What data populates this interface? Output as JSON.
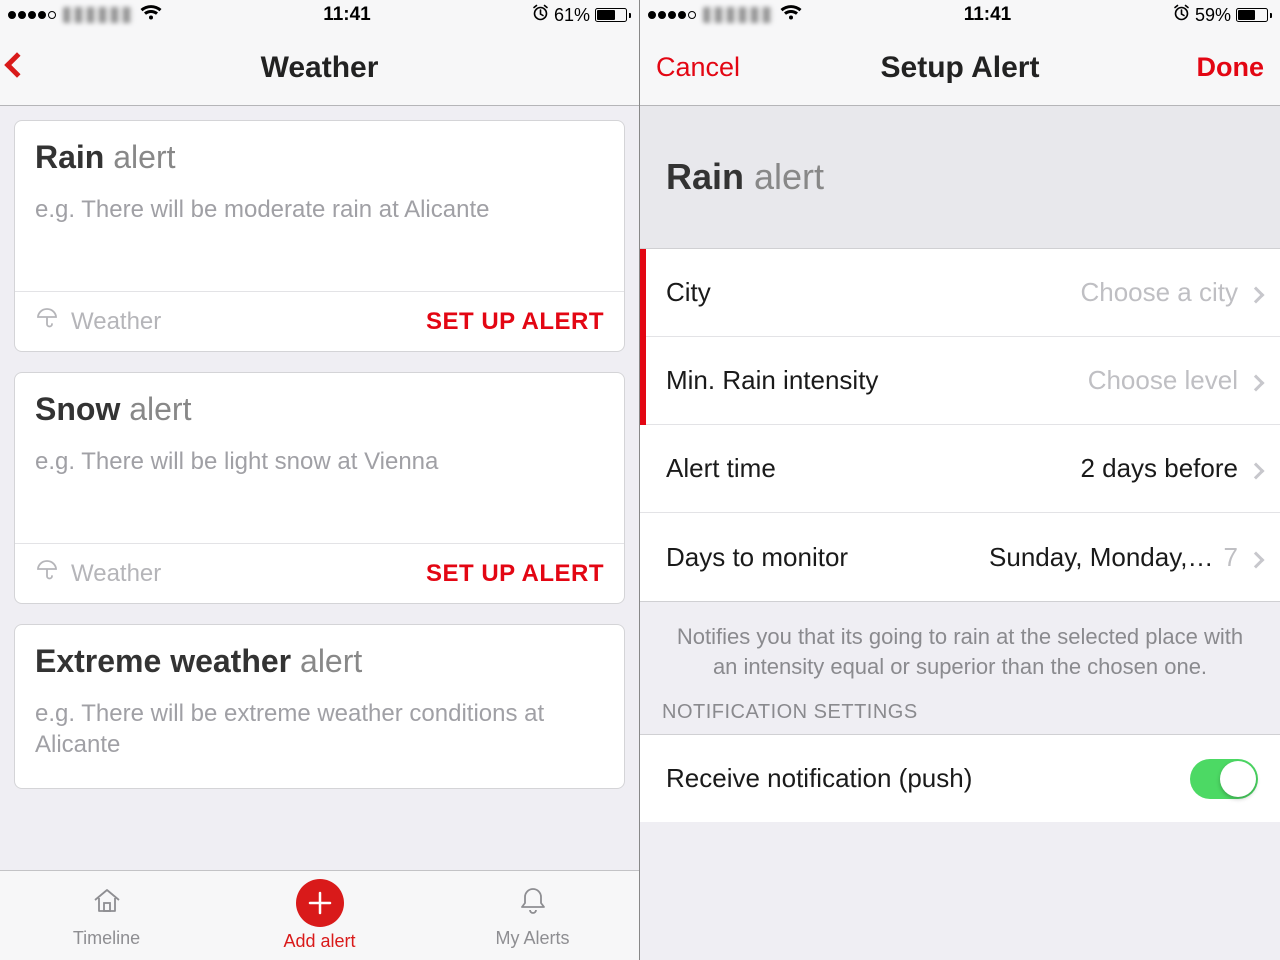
{
  "left": {
    "status": {
      "time": "11:41",
      "battery_pct": "61%",
      "battery_fill": 61
    },
    "nav": {
      "title": "Weather"
    },
    "cards": [
      {
        "title_bold": "Rain",
        "title_rest": " alert",
        "sub": "e.g. There will be moderate rain at Alicante",
        "cat": "Weather",
        "cta": "SET UP ALERT"
      },
      {
        "title_bold": "Snow",
        "title_rest": " alert",
        "sub": "e.g. There will be light snow at Vienna",
        "cat": "Weather",
        "cta": "SET UP ALERT"
      },
      {
        "title_bold": "Extreme weather",
        "title_rest": " alert",
        "sub": "e.g. There will be extreme weather conditions at Alicante",
        "cat": "Weather",
        "cta": "SET UP ALERT"
      }
    ],
    "tabs": {
      "timeline": "Timeline",
      "add": "Add alert",
      "myalerts": "My Alerts"
    }
  },
  "right": {
    "status": {
      "time": "11:41",
      "battery_pct": "59%",
      "battery_fill": 59
    },
    "nav": {
      "cancel": "Cancel",
      "title": "Setup Alert",
      "done": "Done"
    },
    "header": {
      "bold": "Rain",
      "rest": " alert"
    },
    "rows": {
      "city": {
        "label": "City",
        "value": "Choose a city"
      },
      "intensity": {
        "label": "Min. Rain intensity",
        "value": "Choose level"
      },
      "time": {
        "label": "Alert time",
        "value": "2 days before"
      },
      "days": {
        "label": "Days to monitor",
        "value": "Sunday, Monday,…",
        "count": "7"
      }
    },
    "desc": "Notifies you that its going to rain at the selected place with an intensity equal or superior than the chosen one.",
    "section": "NOTIFICATION SETTINGS",
    "push": {
      "label": "Receive notification (push)"
    }
  }
}
